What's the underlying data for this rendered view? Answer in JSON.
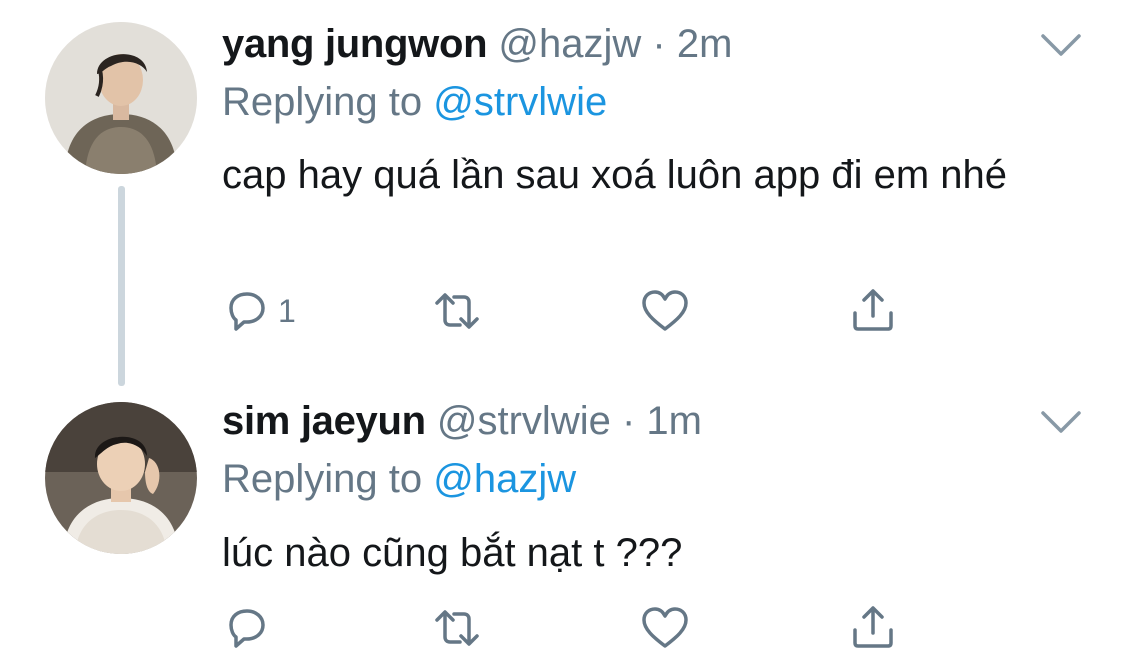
{
  "tweets": [
    {
      "display_name": "yang jungwon",
      "handle": "@hazjw",
      "separator": "·",
      "time": "2m",
      "replying_label": "Replying to",
      "replying_to": "@strvlwie",
      "text": "cap hay quá lần sau xoá luôn app đi em nhé",
      "reply_count": "1",
      "avatar_icon": "avatar-icon"
    },
    {
      "display_name": "sim jaeyun",
      "handle": "@strvlwie",
      "separator": "·",
      "time": "1m",
      "replying_label": "Replying to",
      "replying_to": "@hazjw",
      "text": "lúc nào cũng bắt nạt t ???",
      "reply_count": "",
      "avatar_icon": "avatar-icon"
    }
  ],
  "icons": {
    "reply": "reply-icon",
    "retweet": "retweet-icon",
    "like": "heart-icon",
    "share": "share-icon",
    "menu": "chevron-down-icon"
  },
  "colors": {
    "text": "#14171a",
    "secondary": "#657786",
    "link": "#1b95e0",
    "thread_line": "#ccd6dd",
    "icon": "#657786"
  }
}
